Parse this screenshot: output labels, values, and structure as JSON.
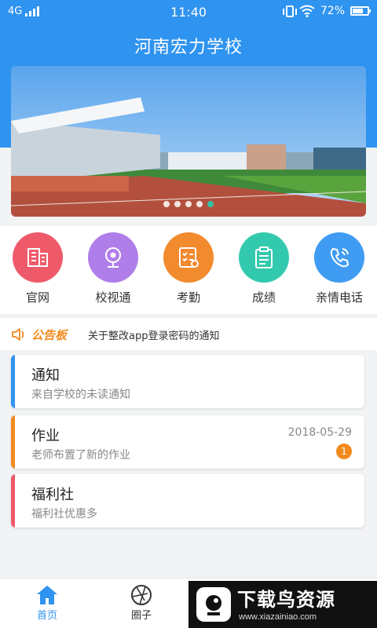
{
  "status": {
    "network": "4G",
    "time": "11:40",
    "battery": "72%",
    "battery_level": 0.72
  },
  "header": {
    "title": "河南宏力学校"
  },
  "banner": {
    "slide_count": 5,
    "active_index": 4
  },
  "entries": [
    {
      "label": "官网",
      "icon": "building-icon",
      "color": "#ef5a6a"
    },
    {
      "label": "校视通",
      "icon": "camera-icon",
      "color": "#b07ee8"
    },
    {
      "label": "考勤",
      "icon": "checklist-icon",
      "color": "#f28a2e"
    },
    {
      "label": "成绩",
      "icon": "clipboard-icon",
      "color": "#33c9ae"
    },
    {
      "label": "亲情电话",
      "icon": "phone-icon",
      "color": "#3f9cf2"
    }
  ],
  "notice": {
    "tag": "公告板",
    "text": "关于整改app登录密码的通知"
  },
  "cards": [
    {
      "title": "通知",
      "subtitle": "来自学校的未读通知",
      "accent": "#2f93f0",
      "date": "",
      "badge": ""
    },
    {
      "title": "作业",
      "subtitle": "老师布置了新的作业",
      "accent": "#f28a1e",
      "date": "2018-05-29",
      "badge": "1"
    },
    {
      "title": "福利社",
      "subtitle": "福利社优惠多",
      "accent": "#ef5a6a",
      "date": "",
      "badge": ""
    }
  ],
  "tabs": [
    {
      "label": "首页",
      "icon": "home-icon",
      "active": true
    },
    {
      "label": "圈子",
      "icon": "aperture-icon",
      "active": false
    }
  ],
  "watermark": {
    "title": "下载鸟资源",
    "url": "www.xiazainiao.com"
  }
}
